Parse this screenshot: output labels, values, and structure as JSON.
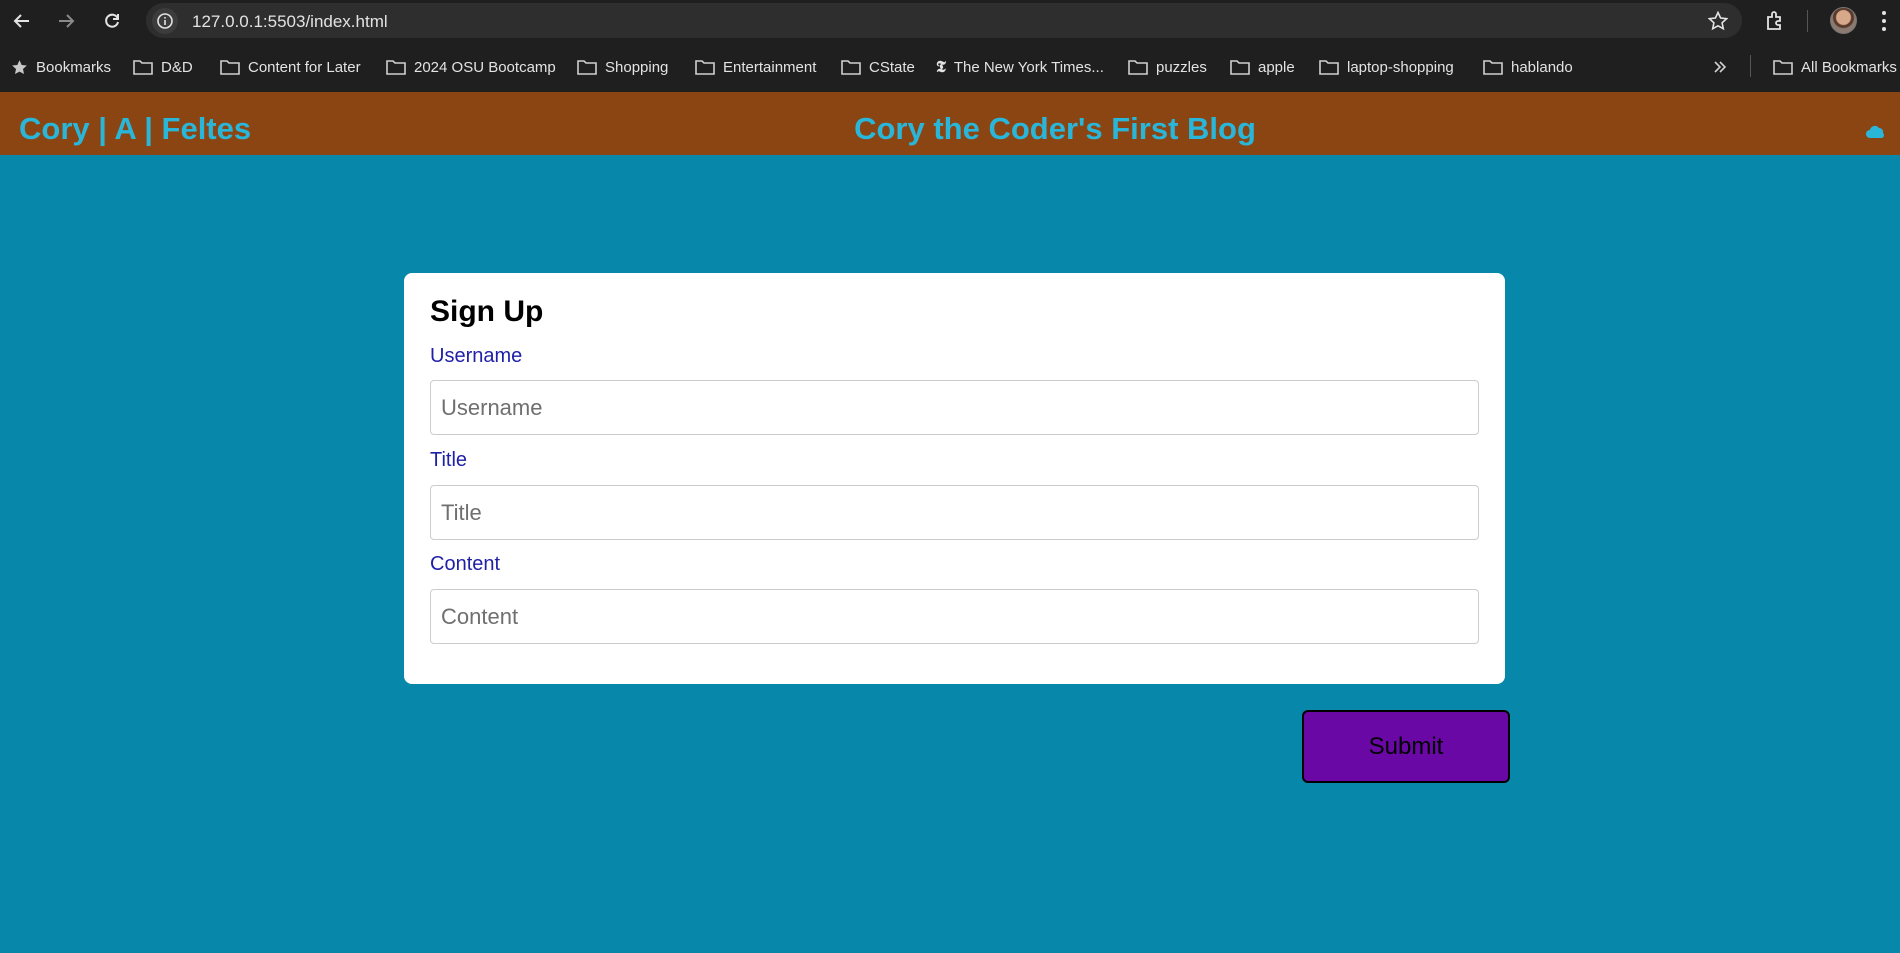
{
  "browser": {
    "url": "127.0.0.1:5503/index.html",
    "bookmarks": [
      {
        "label": "Bookmarks",
        "icon": "star-icon"
      },
      {
        "label": "D&D",
        "icon": "folder-icon"
      },
      {
        "label": "Content for Later",
        "icon": "folder-icon"
      },
      {
        "label": "2024 OSU Bootcamp",
        "icon": "folder-icon"
      },
      {
        "label": "Shopping",
        "icon": "folder-icon"
      },
      {
        "label": "Entertainment",
        "icon": "folder-icon"
      },
      {
        "label": "CState",
        "icon": "folder-icon"
      },
      {
        "label": "The New York Times...",
        "icon": "nyt-icon"
      },
      {
        "label": "puzzles",
        "icon": "folder-icon"
      },
      {
        "label": "apple",
        "icon": "folder-icon"
      },
      {
        "label": "laptop-shopping",
        "icon": "folder-icon"
      },
      {
        "label": "hablando",
        "icon": "folder-icon"
      }
    ],
    "all_bookmarks": "All Bookmarks"
  },
  "header": {
    "brand": "Cory | A | Feltes",
    "title": "Cory the Coder's First Blog",
    "toggle_icon": "cloud-moon-icon"
  },
  "form": {
    "heading": "Sign Up",
    "fields": [
      {
        "label": "Username",
        "placeholder": "Username",
        "value": ""
      },
      {
        "label": "Title",
        "placeholder": "Title",
        "value": ""
      },
      {
        "label": "Content",
        "placeholder": "Content",
        "value": ""
      }
    ],
    "submit_label": "Submit"
  },
  "colors": {
    "page_background": "#0788aa",
    "header_background": "#8b4513",
    "header_text": "#29b6d9",
    "label_text": "#1f1fa8",
    "submit_background": "#6a08a6"
  }
}
